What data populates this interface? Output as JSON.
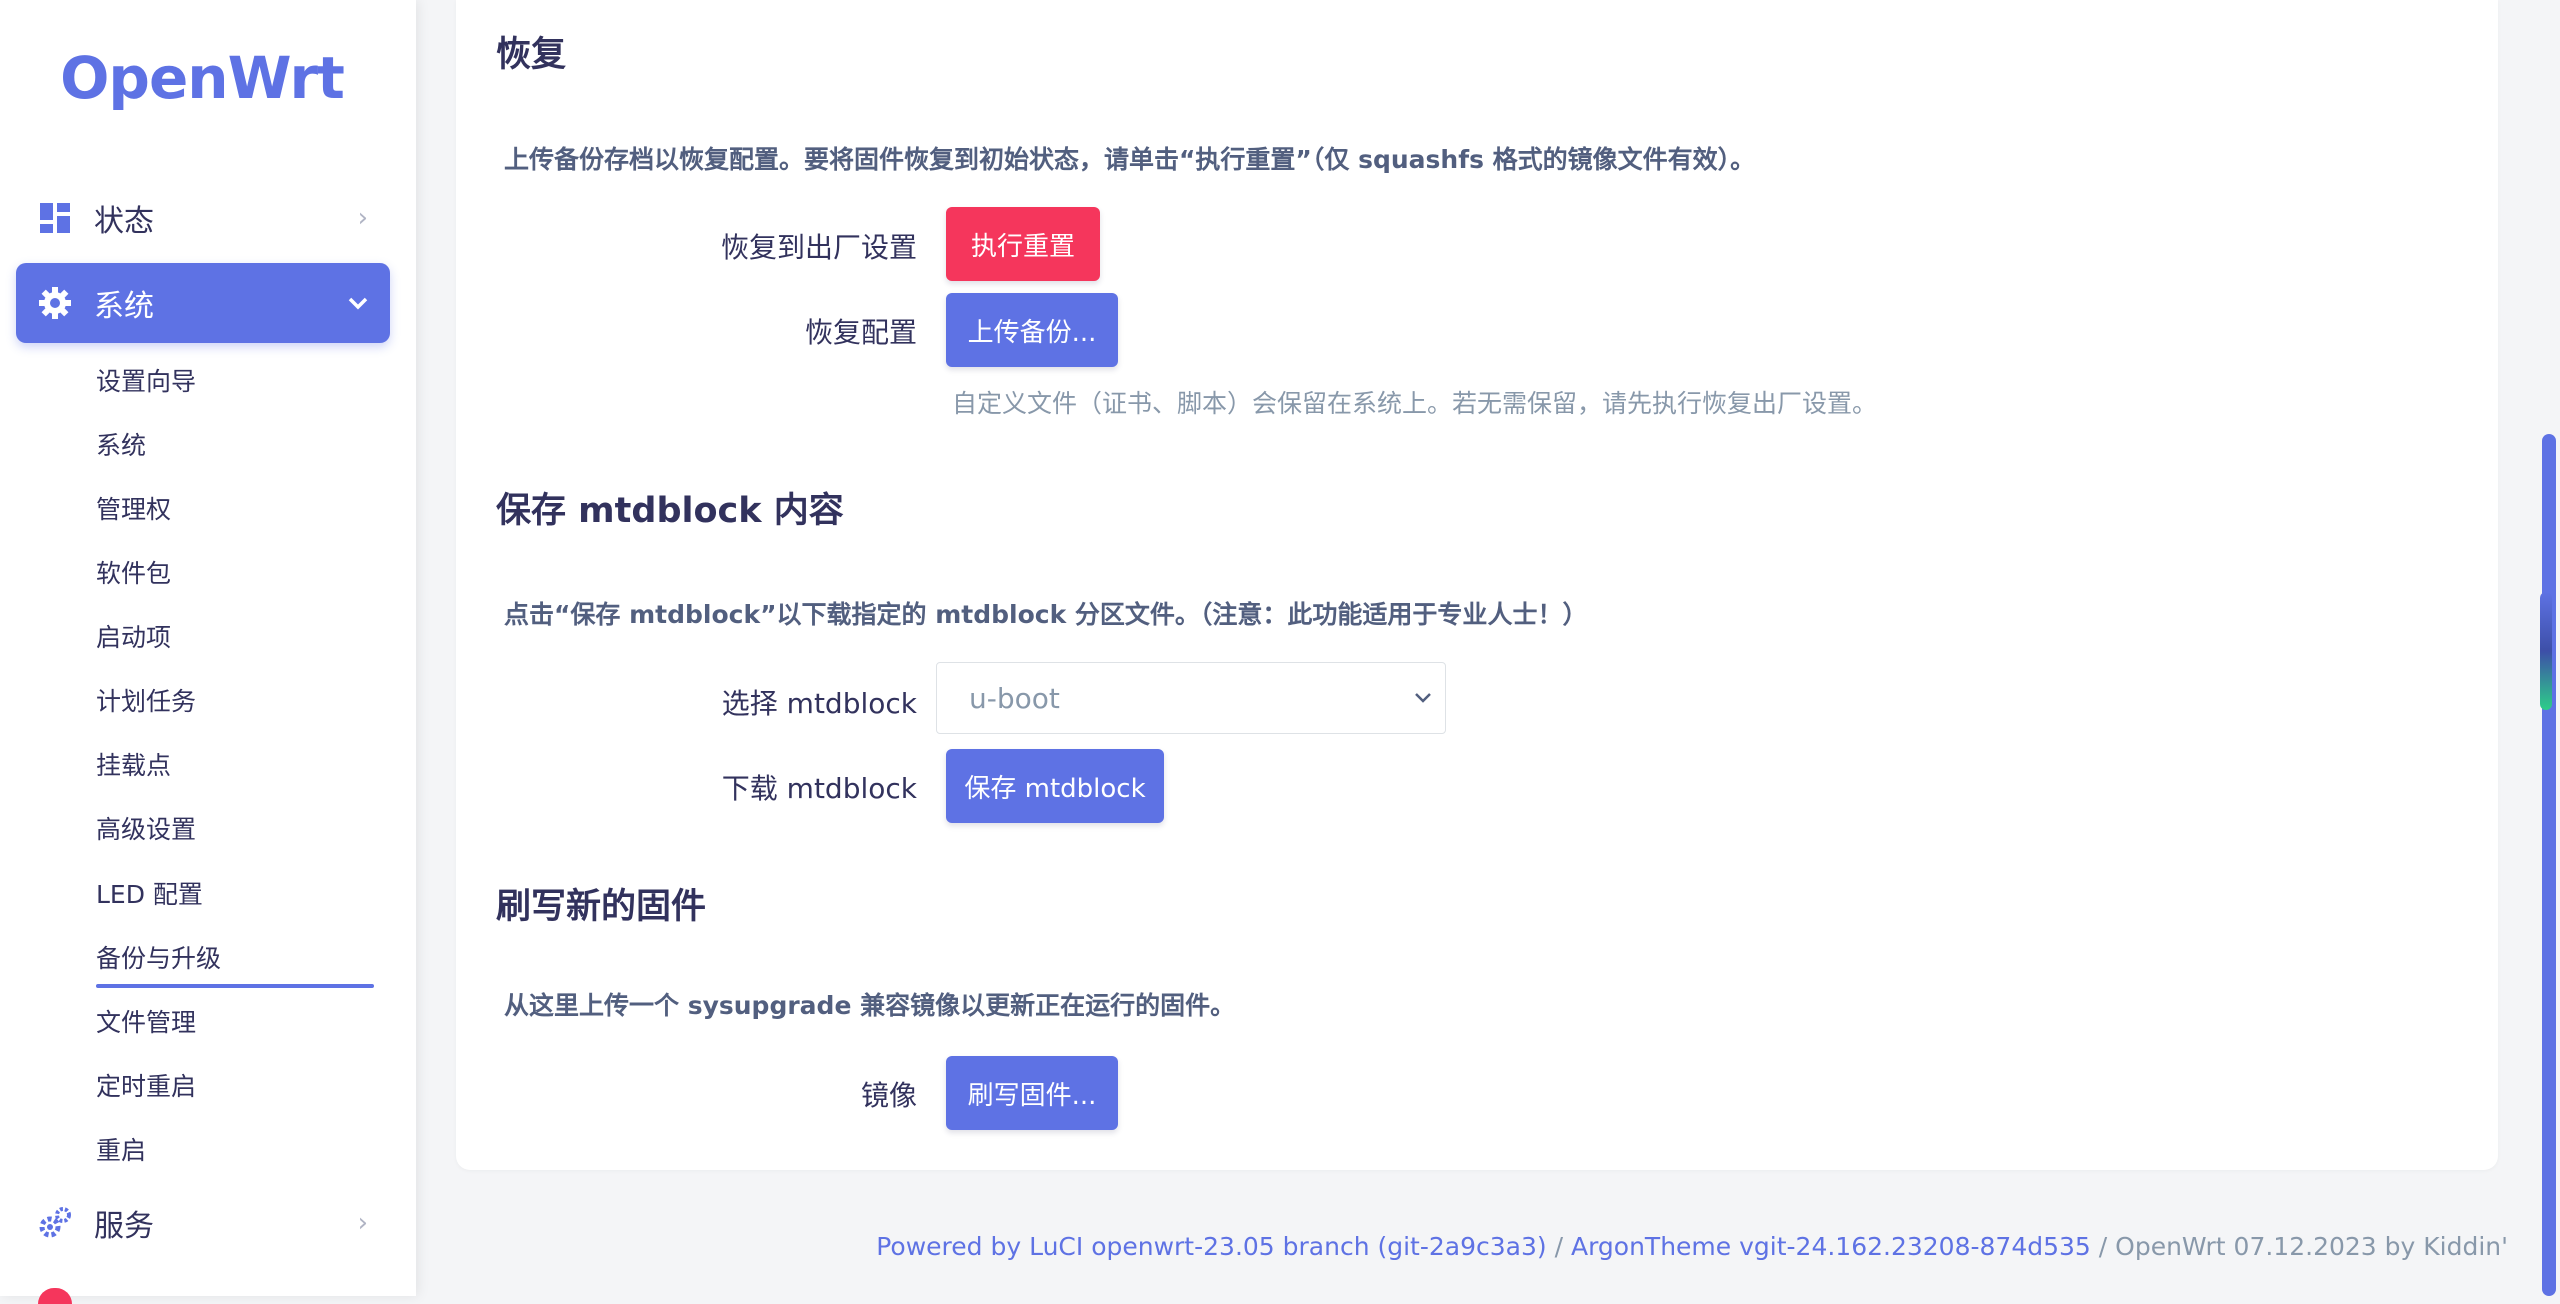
{
  "brand": {
    "logo": "OpenWrt",
    "accent": "#5e72e4",
    "danger": "#f5365c"
  },
  "sidebar": {
    "status": "状态",
    "system": "系统",
    "services": "服务",
    "sub_items": [
      "设置向导",
      "系统",
      "管理权",
      "软件包",
      "启动项",
      "计划任务",
      "挂载点",
      "高级设置",
      "LED 配置",
      "备份与升级",
      "文件管理",
      "定时重启",
      "重启"
    ]
  },
  "restore": {
    "title": "恢复",
    "description": "上传备份存档以恢复配置。要将固件恢复到初始状态，请单击“执行重置”（仅 squashfs 格式的镜像文件有效）。",
    "factory_label": "恢复到出厂设置",
    "reset_button": "执行重置",
    "config_label": "恢复配置",
    "upload_button": "上传备份...",
    "help": "自定义文件（证书、脚本）会保留在系统上。若无需保留，请先执行恢复出厂设置。"
  },
  "mtd": {
    "title": "保存 mtdblock 内容",
    "description": "点击“保存 mtdblock”以下载指定的 mtdblock 分区文件。（注意：此功能适用于专业人士！）",
    "select_label": "选择 mtdblock",
    "selected": "u-boot",
    "download_label": "下载 mtdblock",
    "save_button": "保存 mtdblock"
  },
  "flash": {
    "title": "刷写新的固件",
    "description": "从这里上传一个 sysupgrade 兼容镜像以更新正在运行的固件。",
    "image_label": "镜像",
    "flash_button": "刷写固件..."
  },
  "footer": {
    "luci": "Powered by LuCI openwrt-23.05 branch (git-2a9c3a3)",
    "sep1": " / ",
    "theme": "ArgonTheme vgit-24.162.23208-874d535",
    "sep2": " / ",
    "build": "OpenWrt 07.12.2023 by Kiddin'"
  }
}
